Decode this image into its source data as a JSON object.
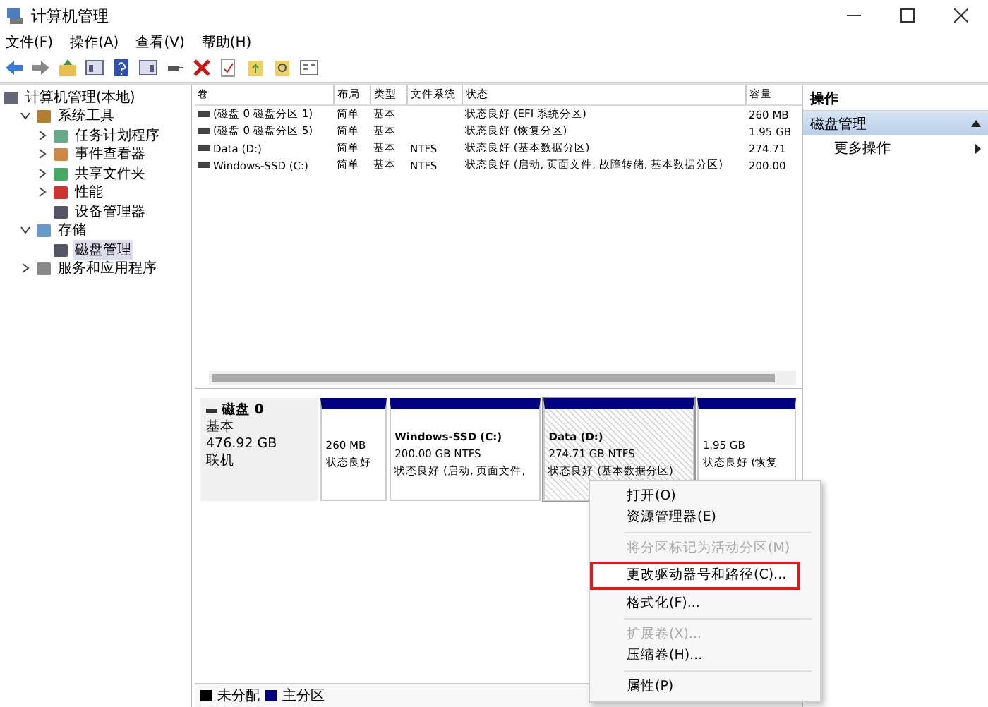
{
  "window": {
    "title": "计算机管理"
  },
  "menu": [
    "文件(F)",
    "操作(A)",
    "查看(V)",
    "帮助(H)"
  ],
  "tree": {
    "label": "计算机管理(本地)",
    "selected": false,
    "children": [
      {
        "label": "系统工具",
        "expanded": true,
        "selected": false,
        "children": [
          {
            "label": "任务计划程序",
            "expanded": false,
            "selected": false
          },
          {
            "label": "事件查看器",
            "expanded": false,
            "selected": false
          },
          {
            "label": "共享文件夹",
            "expanded": false,
            "selected": false
          },
          {
            "label": "性能",
            "expanded": false,
            "selected": false
          },
          {
            "label": "设备管理器",
            "selected": false
          }
        ]
      },
      {
        "label": "存储",
        "expanded": true,
        "selected": false,
        "children": [
          {
            "label": "磁盘管理",
            "selected": true
          }
        ]
      },
      {
        "label": "服务和应用程序",
        "expanded": false,
        "selected": false
      }
    ]
  },
  "volumes": {
    "columns": [
      "卷",
      "布局",
      "类型",
      "文件系统",
      "状态",
      "容量"
    ],
    "rows": [
      [
        "(磁盘 0 磁盘分区 1)",
        "简单",
        "基本",
        "",
        "状态良好 (EFI 系统分区)",
        "260 MB"
      ],
      [
        "(磁盘 0 磁盘分区 5)",
        "简单",
        "基本",
        "",
        "状态良好 (恢复分区)",
        "1.95 GB"
      ],
      [
        "Data (D:)",
        "简单",
        "基本",
        "NTFS",
        "状态良好 (基本数据分区)",
        "274.71"
      ],
      [
        "Windows-SSD (C:)",
        "简单",
        "基本",
        "NTFS",
        "状态良好 (启动, 页面文件, 故障转储, 基本数据分区)",
        "200.00"
      ]
    ]
  },
  "disk": {
    "name": "磁盘 0",
    "type": "基本",
    "size": "476.92 GB",
    "status": "联机",
    "partitions": [
      {
        "size": "260 MB",
        "status": "状态良好",
        "selected": false
      },
      {
        "name": "Windows-SSD  (C:)",
        "size": "200.00 GB NTFS",
        "status": "状态良好 (启动, 页面文件,",
        "selected": false
      },
      {
        "name": "Data  (D:)",
        "size": "274.71 GB NTFS",
        "status": "状态良好 (基本数据分区)",
        "selected": true
      },
      {
        "size": "1.95 GB",
        "status": "状态良好 (恢复",
        "selected": false
      }
    ]
  },
  "legend": [
    {
      "label": "未分配",
      "color": "#000000"
    },
    {
      "label": "主分区",
      "color": "#000080"
    }
  ],
  "actions": {
    "title": "操作",
    "section": "磁盘管理",
    "items": [
      "更多操作"
    ]
  },
  "context_menu": [
    {
      "kind": "item",
      "label": "打开(O)",
      "disabled": false,
      "highlighted": false
    },
    {
      "kind": "item",
      "label": "资源管理器(E)",
      "disabled": false,
      "highlighted": false
    },
    {
      "kind": "separator"
    },
    {
      "kind": "item",
      "label": "将分区标记为活动分区(M)",
      "disabled": true,
      "highlighted": false
    },
    {
      "kind": "item",
      "label": "更改驱动器号和路径(C)...",
      "disabled": false,
      "highlighted": true
    },
    {
      "kind": "item",
      "label": "格式化(F)...",
      "disabled": false,
      "highlighted": false
    },
    {
      "kind": "separator"
    },
    {
      "kind": "item",
      "label": "扩展卷(X)...",
      "disabled": true,
      "highlighted": false
    },
    {
      "kind": "item",
      "label": "压缩卷(H)...",
      "disabled": false,
      "highlighted": false
    },
    {
      "kind": "separator"
    },
    {
      "kind": "item",
      "label": "属性(P)",
      "disabled": false,
      "highlighted": false
    }
  ]
}
